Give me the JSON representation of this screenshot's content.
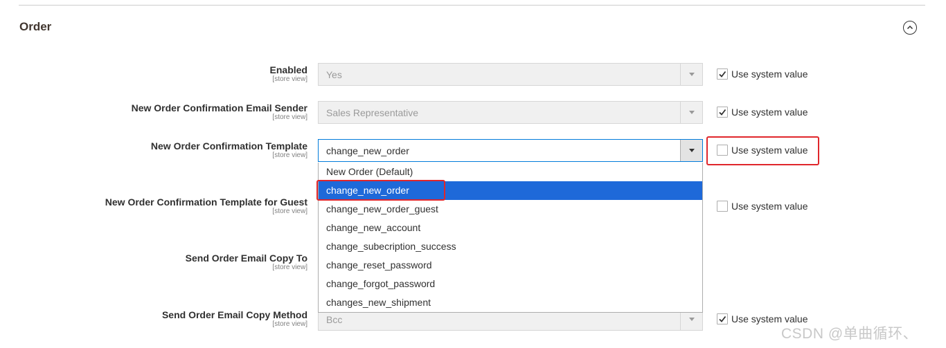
{
  "section": {
    "title": "Order"
  },
  "scope_text": "[store view]",
  "use_system_value": "Use system value",
  "fields": [
    {
      "label": "Enabled",
      "value": "Yes",
      "system_checked": true
    },
    {
      "label": "New Order Confirmation Email Sender",
      "value": "Sales Representative",
      "system_checked": true
    },
    {
      "label": "New Order Confirmation Template",
      "value": "change_new_order",
      "system_checked": false
    },
    {
      "label": "New Order Confirmation Template for Guest",
      "value": "",
      "system_checked": false
    },
    {
      "label": "Send Order Email Copy To",
      "value": "",
      "system_checked": false
    },
    {
      "label": "Send Order Email Copy Method",
      "value": "Bcc",
      "system_checked": true
    }
  ],
  "dropdown": {
    "selected_index": 1,
    "options": [
      "New Order (Default)",
      "change_new_order",
      "change_new_order_guest",
      "change_new_account",
      "change_subecription_success",
      "change_reset_password",
      "change_forgot_password",
      "changes_new_shipment"
    ]
  },
  "colors": {
    "highlight_red": "#e0262b",
    "selected_blue": "#1e69d9"
  },
  "watermark": "CSDN @单曲循环、"
}
